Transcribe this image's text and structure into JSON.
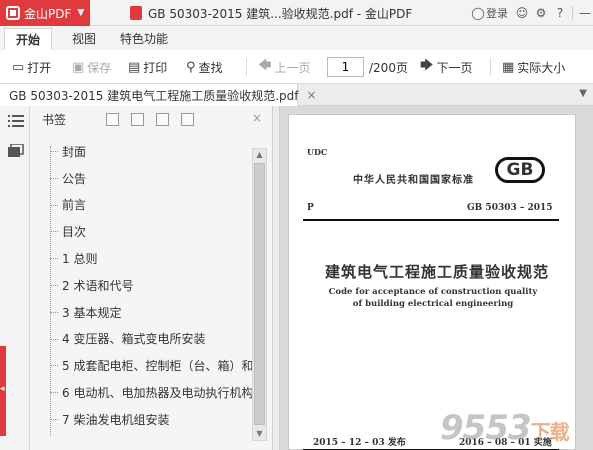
{
  "app": {
    "name": "金山PDF",
    "window_title": "GB 50303-2015 建筑...验收规范.pdf - 金山PDF",
    "login": "登录"
  },
  "ribbon_tabs": [
    "开始",
    "视图",
    "特色功能"
  ],
  "toolbar": {
    "open": "打开",
    "save": "保存",
    "print": "打印",
    "find": "查找",
    "prev": "上一页",
    "page_current": "1",
    "page_total": "/200页",
    "next": "下一页",
    "actual_size": "实际大小"
  },
  "doc_tab": {
    "label": "GB 50303-2015 建筑电气工程施工质量验收规范.pdf",
    "close": "×"
  },
  "bookmarks": {
    "header": "书签",
    "items": [
      "封面",
      "公告",
      "前言",
      "目次",
      "1 总则",
      "2 术语和代号",
      "3 基本规定",
      "4 变压器、箱式变电所安装",
      "5 成套配电柜、控制柜（台、箱）和...",
      "6 电动机、电加热器及电动执行机构...",
      "7 柴油发电机组安装"
    ]
  },
  "page": {
    "udc": "UDC",
    "national": "中华人民共和国国家标准",
    "gb_logo": "GB",
    "p": "P",
    "code": "GB 50303 – 2015",
    "title": "建筑电气工程施工质量验收规范",
    "en_line1": "Code for acceptance of construction quality",
    "en_line2": "of building electrical engineering",
    "issue_date": "2015 – 12 – 03   发布",
    "impl_date": "2016 – 08 – 01   实施"
  },
  "watermark": {
    "digits": "9553",
    "cn": "下载"
  },
  "colors": {
    "accent": "#e0393e"
  }
}
